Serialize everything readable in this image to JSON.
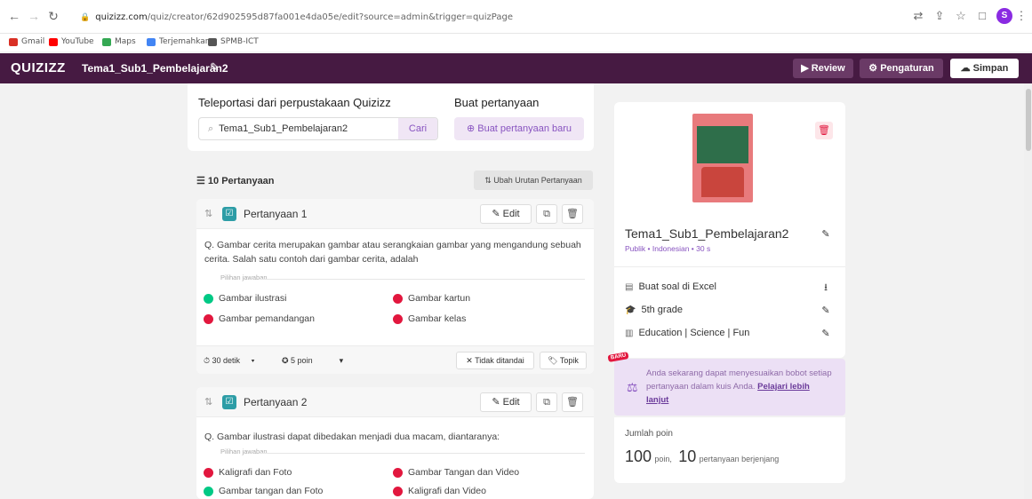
{
  "browser": {
    "url_domain": "quizizz.com",
    "url_path": "/quiz/creator/62d902595d87fa001e4da05e/edit?source=admin&trigger=quizPage",
    "profile_initial": "S",
    "bookmarks": [
      {
        "label": "Gmail",
        "icon_color": "#d93025"
      },
      {
        "label": "YouTube",
        "icon_color": "#ff0000"
      },
      {
        "label": "Maps",
        "icon_color": "#34a853"
      },
      {
        "label": "Terjemahkan",
        "icon_color": "#4285f4"
      },
      {
        "label": "SPMB-ICT",
        "icon_color": "#555555"
      }
    ]
  },
  "header": {
    "logo": "QUIZIZZ",
    "quiz_title": "Tema1_Sub1_Pembelajaran2",
    "review_label": "Review",
    "settings_label": "Pengaturan",
    "save_label": "Simpan"
  },
  "teleport": {
    "title": "Teleportasi dari perpustakaan Quizizz",
    "search_value": "Tema1_Sub1_Pembelajaran2",
    "search_button": "Cari",
    "create_title": "Buat pertanyaan",
    "create_button": "Buat pertanyaan baru"
  },
  "questions_header": {
    "count_label": "10 Pertanyaan",
    "reorder_label": "Ubah Urutan Pertanyaan"
  },
  "questions": [
    {
      "label": "Pertanyaan 1",
      "edit_label": "Edit",
      "text": "Q. Gambar cerita merupakan gambar atau serangkaian gambar yang mengandung sebuah cerita. Salah satu contoh dari gambar cerita, adalah",
      "choices_label": "Pilihan jawaban",
      "choices": [
        {
          "text": "Gambar ilustrasi",
          "correct": true
        },
        {
          "text": "Gambar kartun",
          "correct": false
        },
        {
          "text": "Gambar pemandangan",
          "correct": false
        },
        {
          "text": "Gambar kelas",
          "correct": false
        }
      ],
      "time": "30 detik",
      "points": "5 poin",
      "untagged": "Tidak ditandai",
      "topic": "Topik"
    },
    {
      "label": "Pertanyaan 2",
      "edit_label": "Edit",
      "text": "Q. Gambar ilustrasi dapat dibedakan menjadi dua macam, diantaranya:",
      "choices_label": "Pilihan jawaban",
      "choices": [
        {
          "text": "Kaligrafi dan Foto",
          "correct": false
        },
        {
          "text": "Gambar Tangan dan Video",
          "correct": false
        },
        {
          "text": "Gambar tangan dan Foto",
          "correct": true
        },
        {
          "text": "Kaligrafi dan Video",
          "correct": false
        }
      ]
    }
  ],
  "sidebar": {
    "quiz_name": "Tema1_Sub1_Pembelajaran2",
    "meta": "Publik • Indonesian • 30 s",
    "excel_label": "Buat soal di Excel",
    "grade_label": "5th grade",
    "subjects_label": "Education | Science | Fun",
    "promo_badge": "BARU",
    "promo_text": "Anda sekarang dapat menyesuaikan bobot setiap pertanyaan dalam kuis Anda.",
    "promo_link": "Pelajari lebih lanjut",
    "points_label": "Jumlah poin",
    "points_value": "100",
    "points_unit": "poin,",
    "questions_value": "10",
    "questions_unit": "pertanyaan berjenjang"
  },
  "colors": {
    "header_bg": "#461a42",
    "accent_purple": "#8854c0",
    "correct": "#00c985",
    "incorrect": "#e2173e",
    "question_type": "#2d9da6"
  }
}
